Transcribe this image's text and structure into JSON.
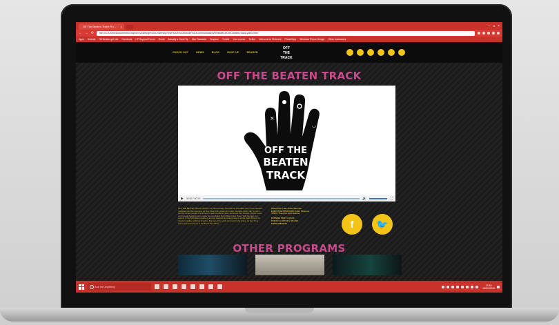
{
  "browser": {
    "tab_title": "Off The Beaten Track Fin...",
    "tab_close": "×",
    "url": "file:///C:/Users/Documents/Graphic%20Design%20University/Year%203%20Module%20Communication/Website/Off-the-beaten-track-video.html",
    "back": "←",
    "forward": "→",
    "reload": "⟳",
    "window_controls": [
      "–",
      "□",
      "×"
    ],
    "bookmarks": [
      "Apps",
      "Hotmail",
      "Off Beaten get info",
      "Facebook",
      "HP Support Forum",
      "Gmail",
      "Actually a Good Tip",
      "Mac Translate",
      "Dropbox",
      "Tumblr",
      "Your course",
      "Twitter",
      "Welcome to Pinterest",
      "PhotoShop",
      "Windows Phone Design",
      "Other bookmarks"
    ]
  },
  "site": {
    "menu": [
      "CHECK OUT",
      "NEWS",
      "BLOG",
      "SHOP UP",
      "SEARCH"
    ],
    "logo_line1": "OFF",
    "logo_line2": "THE",
    "logo_line3": "TRACK",
    "title": "OFF THE BEATEN TRACK",
    "video": {
      "hand_text_line1": "OFF THE",
      "hand_text_line2": "BEATEN",
      "hand_text_line3": "TRACK",
      "play": "▶",
      "time": "00:00 / 00:00",
      "volume": "🔊",
      "fullscreen": "⛶"
    },
    "description": "OFF THE BEATEN TRACK (2015) is the documentary that tells the incredible story of two talented musicians and the past year, as they travel to the heart of London, Jamaica, Paris, Italy, London and the unique people of America to meet new Music ideas, as well as their studios, people, touch and musical background to create the soundtrack that is Brand New Music. With the help and support of the Bold Brand Academy and the talented filmmakers used in all the Radio Brand, the Cleanel creative publisher brand on this part of the world are found in the studio, as they bring their experiences home to the Brand New Music.",
    "credits": [
      "DIRECTOR: Luke Potter-Marsden",
      "EXECUTIVE PRODUCER: Pablo Filippone",
      "VIDEO: Theodore Jean Delarue",
      "",
      "RUNNING TIME: 01:03:00",
      "FIND FULL DETAILS ON LINK",
      "ENTER WEBSITE"
    ],
    "facebook_glyph": "f",
    "twitter_glyph": "🐦",
    "other_title": "OTHER PROGRAMS"
  },
  "taskbar": {
    "search_placeholder": "Ask me anything",
    "time": "13:46",
    "date": "15/01/2015"
  },
  "colors": {
    "accent_pink": "#c84a8a",
    "accent_yellow": "#f2c418",
    "chrome_red": "#c8322a"
  }
}
